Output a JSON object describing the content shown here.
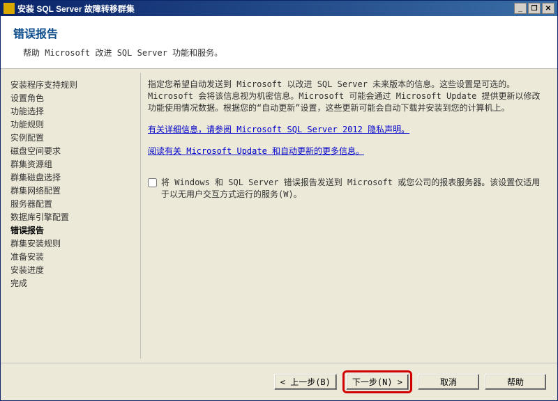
{
  "window": {
    "title": "安装 SQL Server 故障转移群集"
  },
  "header": {
    "title": "错误报告",
    "subtitle": "帮助 Microsoft 改进 SQL Server 功能和服务。"
  },
  "sidebar": {
    "items": [
      "安装程序支持规则",
      "设置角色",
      "功能选择",
      "功能规则",
      "实例配置",
      "磁盘空间要求",
      "群集资源组",
      "群集磁盘选择",
      "群集网络配置",
      "服务器配置",
      "数据库引擎配置",
      "错误报告",
      "群集安装规则",
      "准备安装",
      "安装进度",
      "完成"
    ],
    "activeIndex": 11
  },
  "content": {
    "paragraph": "指定您希望自动发送到 Microsoft 以改进 SQL Server 未来版本的信息。这些设置是可选的。Microsoft 会将该信息视为机密信息。Microsoft 可能会通过 Microsoft Update 提供更新以修改功能使用情况数据。根据您的“自动更新”设置，这些更新可能会自动下载并安装到您的计算机上。",
    "link1": "有关详细信息，请参阅 Microsoft SQL Server 2012 隐私声明。",
    "link2": "阅读有关 Microsoft Update 和自动更新的更多信息。",
    "checkboxLabel": "将 Windows 和 SQL Server 错误报告发送到 Microsoft 或您公司的报表服务器。该设置仅适用于以无用户交互方式运行的服务(W)。"
  },
  "footer": {
    "back": "< 上一步(B)",
    "next": "下一步(N) >",
    "cancel": "取消",
    "help": "帮助"
  }
}
